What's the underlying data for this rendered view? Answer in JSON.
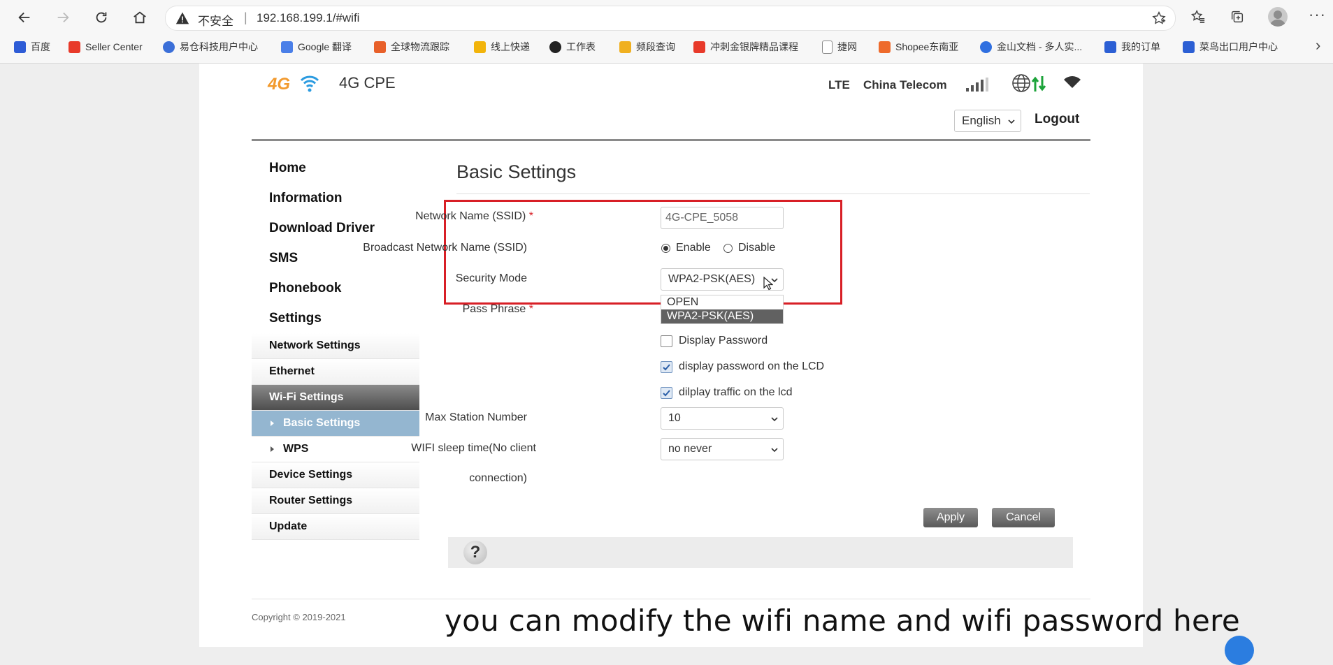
{
  "browser": {
    "insecure_label": "不安全",
    "separator": "|",
    "url": "192.168.199.1/#wifi",
    "more": "···",
    "bookmark_next": "›",
    "bookmarks": [
      {
        "label": "百度",
        "color": "#2e5cd6"
      },
      {
        "label": "Seller Center",
        "color": "#e83a2a"
      },
      {
        "label": "易仓科技用户中心",
        "color": "#3b6fd8"
      },
      {
        "label": "Google 翻译",
        "color": "#4a7fe8"
      },
      {
        "label": "全球物流跟踪",
        "color": "#e8602a"
      },
      {
        "label": "线上快递",
        "color": "#f2b40b"
      },
      {
        "label": "工作表",
        "color": "#222222"
      },
      {
        "label": "频段查询",
        "color": "#f0b020"
      },
      {
        "label": "冲刺金银牌精品课程",
        "color": "#e83a2a"
      },
      {
        "label": "捷网",
        "color": "#888888"
      },
      {
        "label": "Shopee东南亚",
        "color": "#ee6a2b"
      },
      {
        "label": "金山文档 - 多人实...",
        "color": "#2f6fe0"
      },
      {
        "label": "我的订单",
        "color": "#2c5fd4"
      },
      {
        "label": "菜鸟出口用户中心",
        "color": "#2c5fd4"
      }
    ]
  },
  "header": {
    "logo_text": "4G",
    "product": "4G CPE",
    "network_type": "LTE",
    "carrier": "China Telecom",
    "language": "English",
    "logout": "Logout"
  },
  "sidebar": {
    "main": [
      "Home",
      "Information",
      "Download Driver",
      "SMS",
      "Phonebook",
      "Settings"
    ],
    "settings_sub": [
      {
        "label": "Network Settings",
        "active": false
      },
      {
        "label": "Ethernet",
        "active": false
      },
      {
        "label": "Wi-Fi Settings",
        "active": true
      }
    ],
    "wifi_sub": [
      {
        "label": "Basic Settings",
        "active": true
      },
      {
        "label": "WPS",
        "active": false
      }
    ],
    "tail": [
      "Device Settings",
      "Router Settings",
      "Update"
    ]
  },
  "content": {
    "title": "Basic Settings",
    "ssid_label": "Network Name (SSID)",
    "required_mark": "*",
    "ssid_value": "4G-CPE_5058",
    "broadcast_label": "Broadcast Network Name (SSID)",
    "enable_label": "Enable",
    "disable_label": "Disable",
    "security_label": "Security Mode",
    "security_value": "WPA2-PSK(AES)",
    "security_options": [
      "OPEN",
      "WPA2-PSK(AES)"
    ],
    "passphrase_label": "Pass Phrase",
    "display_password": "Display Password",
    "display_lcd": "display password on the LCD",
    "display_traffic": "dilplay traffic on the lcd",
    "max_station_label": "Max Station Number",
    "max_station_value": "10",
    "sleep_label_1": "WIFI sleep time(No client",
    "sleep_label_2": "connection)",
    "sleep_value": "no never",
    "apply": "Apply",
    "cancel": "Cancel",
    "help": "?"
  },
  "footer": {
    "copyright": "Copyright © 2019-2021"
  },
  "caption": "you can modify the wifi name and wifi password here"
}
